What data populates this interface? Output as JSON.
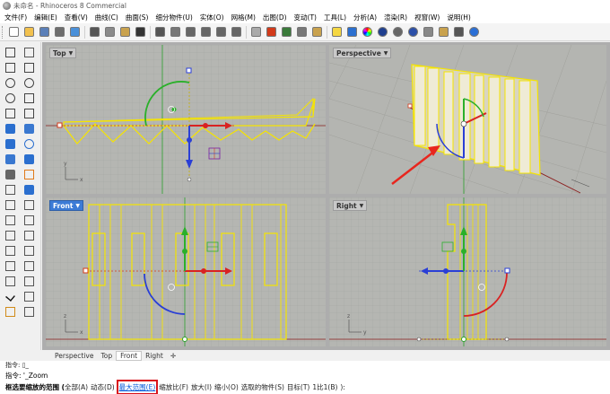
{
  "window": {
    "title": "未命名 - Rhinoceros 8 Commercial"
  },
  "menu": [
    "文件(F)",
    "编辑(E)",
    "查看(V)",
    "曲线(C)",
    "曲面(S)",
    "细分物件(U)",
    "实体(O)",
    "网格(M)",
    "出图(D)",
    "变动(T)",
    "工具(L)",
    "分析(A)",
    "渲染(R)",
    "视窗(W)",
    "说明(H)"
  ],
  "viewports": {
    "top": {
      "label": "Top"
    },
    "perspective": {
      "label": "Perspective"
    },
    "front": {
      "label": "Front"
    },
    "right": {
      "label": "Right"
    }
  },
  "viewport_tabs": [
    "Perspective",
    "Top",
    "Front",
    "Right"
  ],
  "viewport_tab_add": "✛",
  "active_tab": "Front",
  "command": {
    "history": "指令: ▯_",
    "line": "指令: '_Zoom",
    "prompt_label": "框选要缩放的范围 (",
    "options": [
      "全部(A)",
      "动态(D)"
    ],
    "highlighted_option": "最大范围(E)",
    "options_after": [
      "缩放比(F)",
      "放大(I)",
      "缩小(O)",
      "选取的物件(S)",
      "目标(T)",
      "1比1(B)"
    ],
    "prompt_end": "):"
  },
  "icons": {
    "toolbar": [
      "new-file",
      "open",
      "save",
      "print",
      "import",
      "cut",
      "copy",
      "paste",
      "undo",
      "pan",
      "rotate-view",
      "zoom-window",
      "zoom-extents",
      "zoom-selected",
      "zoom-dynamic",
      "grid",
      "car",
      "named-view",
      "print-view",
      "lock",
      "bulb",
      "layer",
      "color-wheel",
      "render",
      "render-mesh",
      "sphere",
      "options",
      "wand",
      "plugin",
      "help"
    ],
    "leftbar": [
      "select",
      "point",
      "polyline",
      "curve",
      "circle",
      "arc",
      "ellipse",
      "rectangle",
      "polygon",
      "fillet-curve",
      "surface-corner",
      "surface-extrude",
      "box",
      "sphere",
      "cylinder",
      "cone",
      "pipe",
      "boolean",
      "mesh",
      "mesh-box",
      "explode",
      "join",
      "trim",
      "split",
      "move",
      "copy",
      "rotate",
      "scale",
      "mirror",
      "array",
      "text",
      "dimension",
      "check",
      "analyze",
      "render-tool",
      "light"
    ]
  },
  "colors": {
    "accent": "#3c7bd6",
    "selection": "#f5e400",
    "highlight_box": "#d9141c"
  }
}
